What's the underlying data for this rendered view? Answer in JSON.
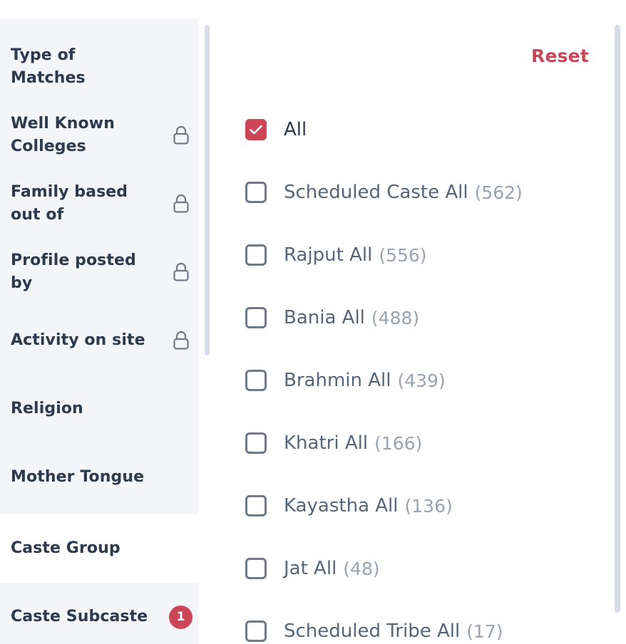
{
  "sidebar": {
    "items": [
      {
        "label": "Type of Matches",
        "locked": false
      },
      {
        "label": "Well Known Colleges",
        "locked": true
      },
      {
        "label": "Family based out of",
        "locked": true
      },
      {
        "label": "Profile posted by",
        "locked": true
      },
      {
        "label": "Activity on site",
        "locked": true
      },
      {
        "label": "Religion",
        "locked": false
      },
      {
        "label": "Mother Tongue",
        "locked": false
      },
      {
        "label": "Caste Group",
        "locked": false,
        "active": true
      },
      {
        "label": "Caste Subcaste",
        "locked": false,
        "badge": "1"
      }
    ],
    "lock_icon": "lock-icon"
  },
  "content": {
    "reset_label": "Reset",
    "options": [
      {
        "label": "All",
        "count": "",
        "checked": true
      },
      {
        "label": "Scheduled Caste All",
        "count": "(562)",
        "checked": false
      },
      {
        "label": "Rajput All",
        "count": "(556)",
        "checked": false
      },
      {
        "label": "Bania All",
        "count": "(488)",
        "checked": false
      },
      {
        "label": "Brahmin All",
        "count": "(439)",
        "checked": false
      },
      {
        "label": "Khatri All",
        "count": "(166)",
        "checked": false
      },
      {
        "label": "Kayastha All",
        "count": "(136)",
        "checked": false
      },
      {
        "label": "Jat All",
        "count": "(48)",
        "checked": false
      },
      {
        "label": "Scheduled Tribe All",
        "count": "(17)",
        "checked": false
      }
    ]
  },
  "colors": {
    "accent": "#cd4658",
    "sidebar_bg": "#f4f5f9",
    "text_dark": "#2b3a4e",
    "text_muted": "#9aa4b1"
  }
}
